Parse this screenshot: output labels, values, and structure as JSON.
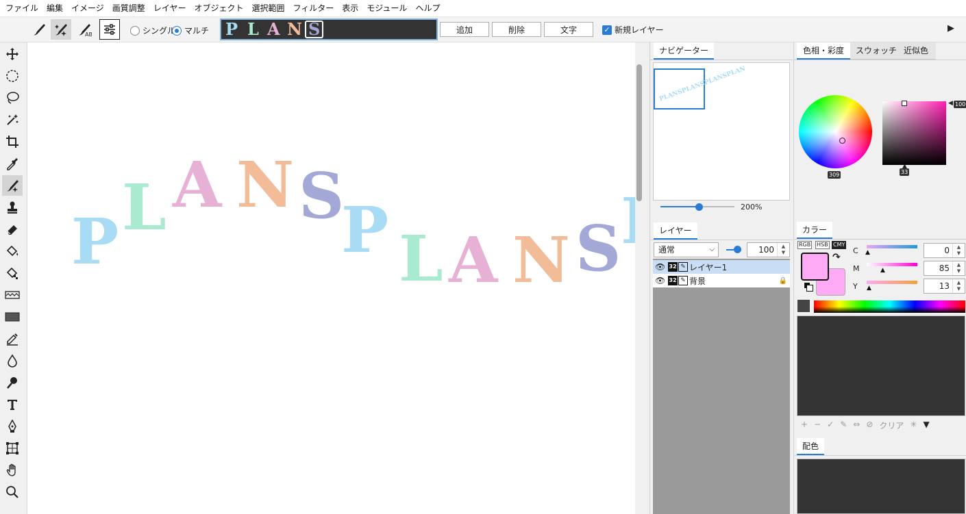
{
  "menu": [
    "ファイル",
    "編集",
    "イメージ",
    "画質調整",
    "レイヤー",
    "オブジェクト",
    "選択範囲",
    "フィルター",
    "表示",
    "モジュール",
    "ヘルプ"
  ],
  "toolbar": {
    "mode_single": "シングル",
    "mode_multi": "マルチ",
    "pattern_letters": [
      {
        "ch": "P",
        "color": "#a8dcf5"
      },
      {
        "ch": "L",
        "color": "#a9ead0"
      },
      {
        "ch": "A",
        "color": "#e6b1d4"
      },
      {
        "ch": "N",
        "color": "#f3bc98"
      },
      {
        "ch": "S",
        "color": "#a3a8d6"
      }
    ],
    "add_label": "追加",
    "delete_label": "削除",
    "text_label": "文字",
    "new_layer_label": "新規レイヤー",
    "more_arrow": "▶"
  },
  "canvas": {
    "letters": [
      "P",
      "L",
      "A",
      "N",
      "S",
      "P",
      "L",
      "A",
      "N",
      "S",
      "P"
    ],
    "colors": [
      "#a8dcf5",
      "#a9ead0",
      "#e6b1d4",
      "#f3bc98",
      "#a3a8d6"
    ]
  },
  "navigator": {
    "tab": "ナビゲーター",
    "zoom": "200%",
    "preview_text": "PLANSPLANSPLANSPLAN"
  },
  "layers": {
    "tab": "レイヤー",
    "blend_mode": "通常",
    "opacity": "100",
    "items": [
      {
        "name": "レイヤー1",
        "bits": "32",
        "selected": true,
        "locked": false
      },
      {
        "name": "背景",
        "bits": "32",
        "selected": false,
        "locked": true
      }
    ]
  },
  "color_panel": {
    "tabs": [
      "色相・彩度",
      "スウォッチ",
      "近似色"
    ],
    "hue_label": "309",
    "sat_label": "33",
    "val_label": "100",
    "color_tab": "カラー",
    "modes": [
      "RGB",
      "HSB",
      "CMY"
    ],
    "active_mode": "CMY",
    "channels": [
      {
        "name": "C",
        "value": "0"
      },
      {
        "name": "M",
        "value": "85"
      },
      {
        "name": "Y",
        "value": "13"
      }
    ],
    "fg_color": "#ffaaf4",
    "swatch_tools": [
      "+",
      "−",
      "✓",
      "✎",
      "⇔",
      "⊘",
      "クリア",
      "✳",
      "▼"
    ],
    "harmony_tab": "配色"
  }
}
